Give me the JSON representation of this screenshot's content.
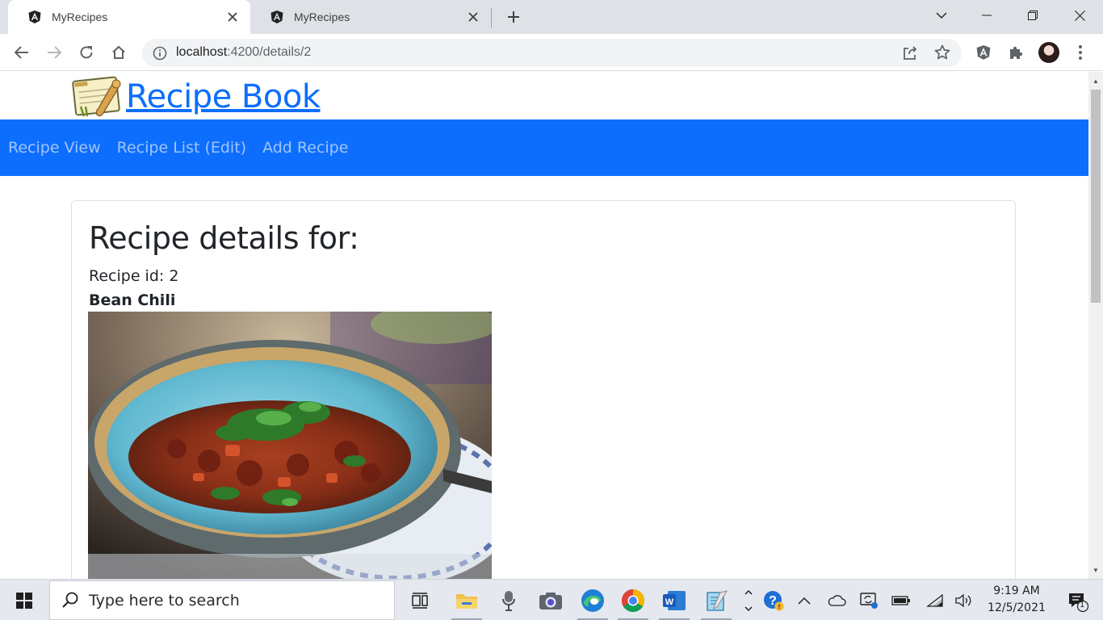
{
  "browser": {
    "tabs": [
      {
        "title": "MyRecipes",
        "active": true
      },
      {
        "title": "MyRecipes",
        "active": false
      }
    ],
    "url_host": "localhost",
    "url_path": ":4200/details/2"
  },
  "page": {
    "brand_title": "Recipe Book",
    "nav": [
      "Recipe View",
      "Recipe List (Edit)",
      "Add Recipe"
    ],
    "heading": "Recipe details for:",
    "recipe_id_text": "Recipe id: 2",
    "recipe_name": "Bean Chili"
  },
  "taskbar": {
    "search_placeholder": "Type here to search",
    "time": "9:19 AM",
    "date": "12/5/2021",
    "notification_count": "1"
  },
  "colors": {
    "navbar": "#0d6efd",
    "brand_link": "#0d6efd",
    "tabstrip": "#dee1e6"
  }
}
